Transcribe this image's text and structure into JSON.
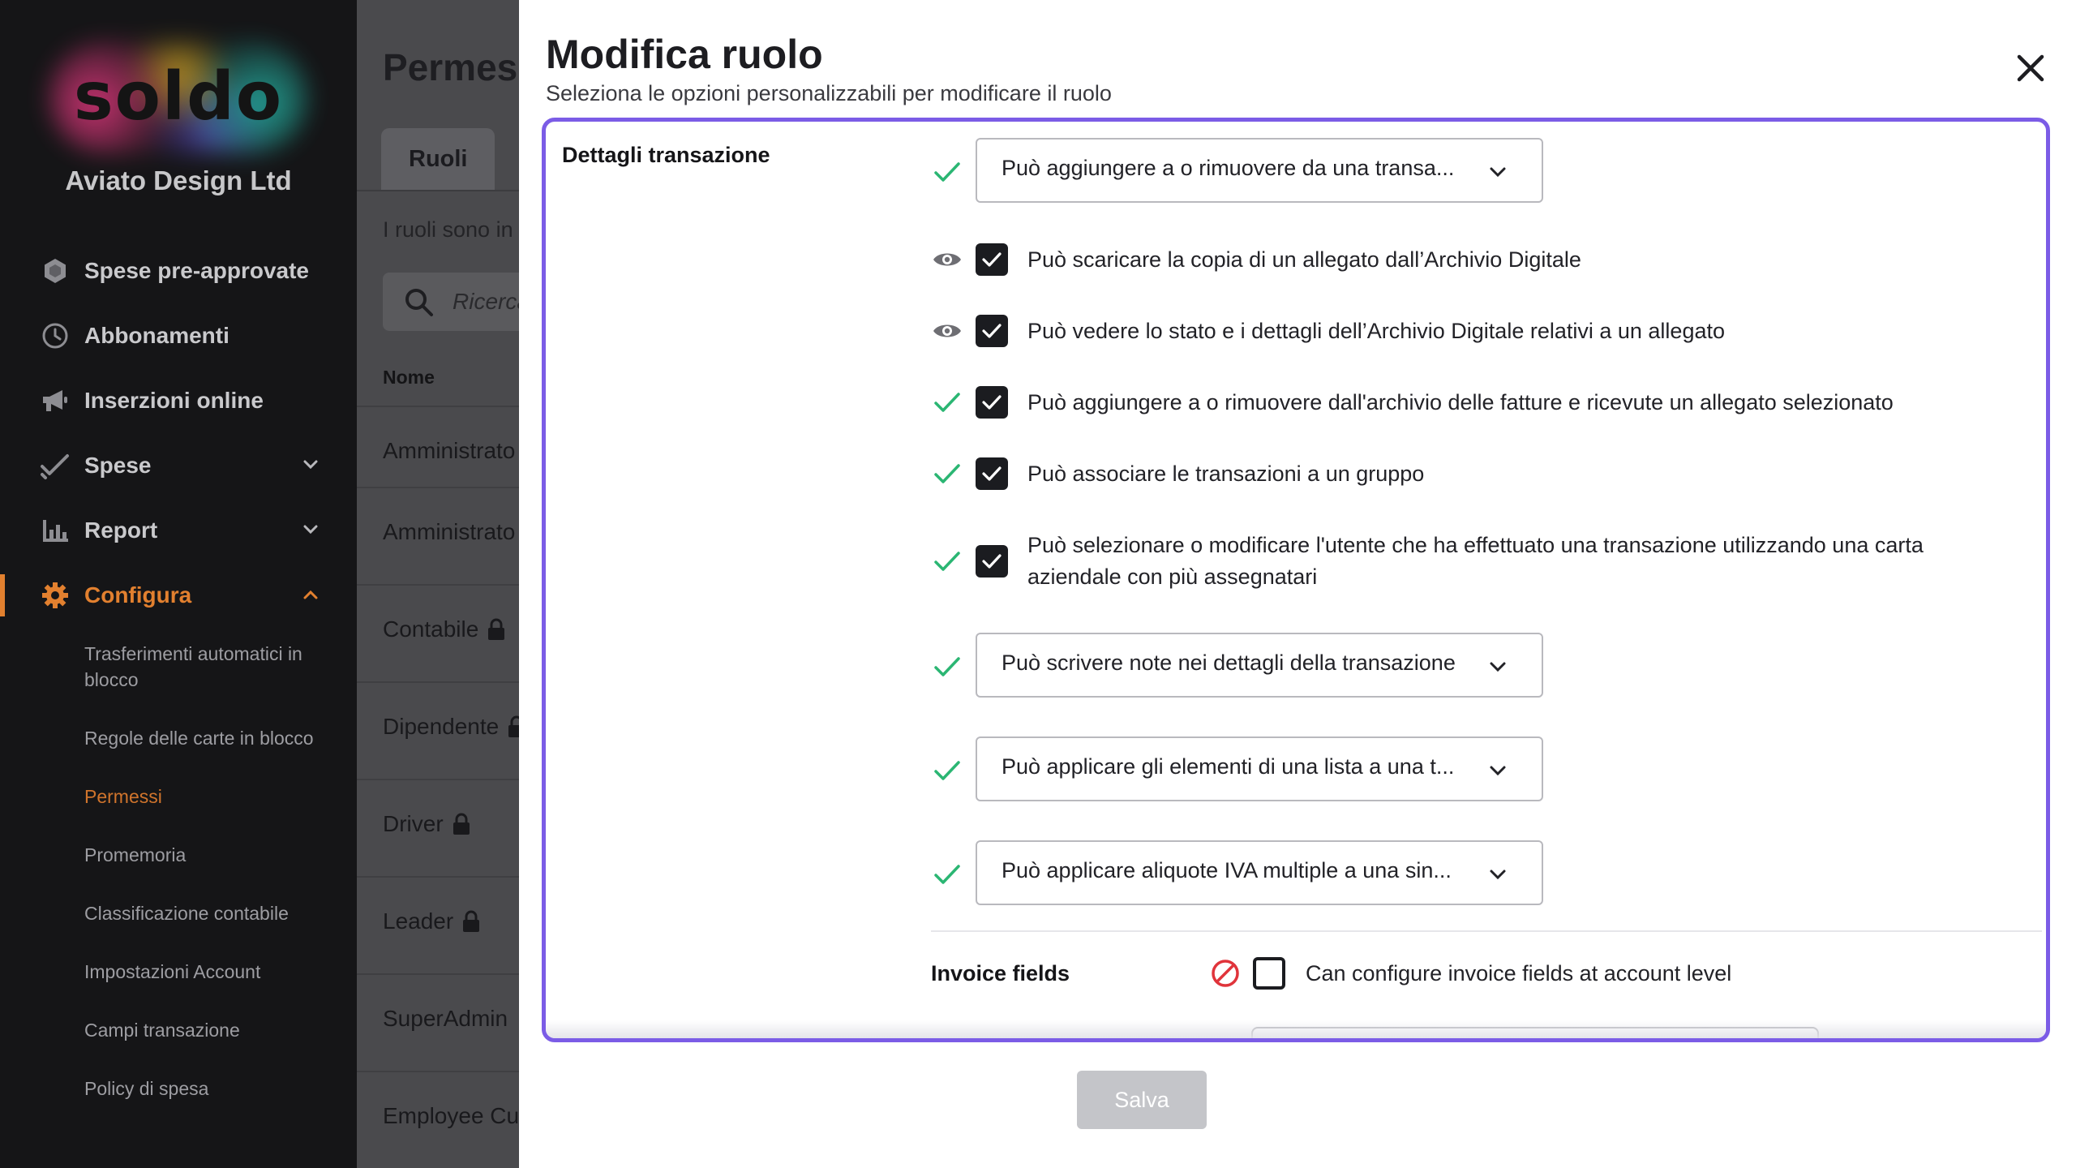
{
  "sidebar": {
    "logo_text": "soldo",
    "company_name": "Aviato Design Ltd",
    "nav": [
      {
        "label": "Spese pre-approvate",
        "icon": "hexagon-icon"
      },
      {
        "label": "Abbonamenti",
        "icon": "clock-icon"
      },
      {
        "label": "Inserzioni online",
        "icon": "megaphone-icon"
      },
      {
        "label": "Spese",
        "icon": "check-double-icon"
      },
      {
        "label": "Report",
        "icon": "bar-chart-icon"
      },
      {
        "label": "Configura",
        "icon": "gear-icon"
      }
    ],
    "sub": [
      {
        "label": "Trasferimenti automatici in blocco"
      },
      {
        "label": "Regole delle carte in blocco"
      },
      {
        "label": "Permessi"
      },
      {
        "label": "Promemoria"
      },
      {
        "label": "Classificazione contabile"
      },
      {
        "label": "Impostazioni Account"
      },
      {
        "label": "Campi transazione"
      },
      {
        "label": "Policy di spesa"
      }
    ]
  },
  "background_page": {
    "title": "Permes",
    "tab": "Ruoli",
    "hint": "I ruoli sono in",
    "search_placeholder": "Ricerca",
    "column_header": "Nome",
    "rows": [
      {
        "name": "Amministrato"
      },
      {
        "name": "Amministrato"
      },
      {
        "name": "Contabile"
      },
      {
        "name": "Dipendente"
      },
      {
        "name": "Driver"
      },
      {
        "name": "Leader"
      },
      {
        "name": "SuperAdmin"
      },
      {
        "name": "Employee Cus"
      }
    ]
  },
  "modal": {
    "title": "Modifica ruolo",
    "subtitle": "Seleziona le opzioni personalizzabili per modificare il ruolo",
    "section_label": "Dettagli transazione",
    "options": [
      {
        "type": "dropdown",
        "status": "check",
        "text": "Può aggiungere a o rimuovere da una transa..."
      },
      {
        "type": "checkbox",
        "status": "eye",
        "checked": true,
        "text": "Può scaricare la copia di un allegato dall’Archivio Digitale"
      },
      {
        "type": "checkbox",
        "status": "eye",
        "checked": true,
        "text": "Può vedere lo stato e i dettagli dell’Archivio Digitale relativi a un allegato"
      },
      {
        "type": "checkbox",
        "status": "check",
        "checked": true,
        "text": "Può aggiungere a o rimuovere dall'archivio delle fatture e ricevute un allegato selezionato"
      },
      {
        "type": "checkbox",
        "status": "check",
        "checked": true,
        "text": "Può associare le transazioni a un gruppo"
      },
      {
        "type": "checkbox",
        "status": "check",
        "checked": true,
        "text_line1": "Può selezionare o modificare l'utente che ha effettuato una transazione utilizzando una carta",
        "text_line2": "aziendale con più assegnatari"
      },
      {
        "type": "dropdown",
        "status": "check",
        "text": "Può scrivere note nei dettagli della transazione"
      },
      {
        "type": "dropdown",
        "status": "check",
        "text": "Può applicare gli elementi di una lista a una t..."
      },
      {
        "type": "dropdown",
        "status": "check",
        "text": "Può applicare aliquote IVA multiple a una sin..."
      }
    ],
    "invoice_section": {
      "label": "Invoice fields",
      "status": "forbidden",
      "checked": false,
      "text": "Can configure invoice fields at account level"
    },
    "save_label": "Salva"
  },
  "colors": {
    "accent": "#7b5ce6",
    "active_nav": "#e2802f",
    "check_green": "#2bb673",
    "forbidden_red": "#e0343b",
    "sidebar_bg": "#151517"
  }
}
